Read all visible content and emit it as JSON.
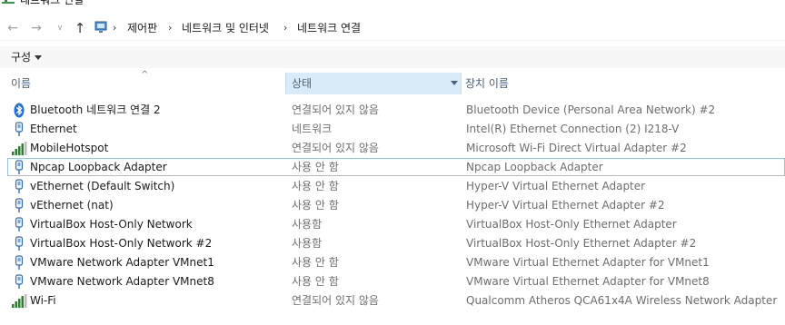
{
  "window": {
    "title": "네트워크 연결"
  },
  "address_bar": {
    "breadcrumbs": [
      "제어판",
      "네트워크 및 인터넷",
      "네트워크 연결"
    ],
    "separator": "›"
  },
  "toolbar": {
    "organize_label": "구성"
  },
  "columns": {
    "name": "이름",
    "status": "상태",
    "device": "장치 이름",
    "sort_indicator": "^"
  },
  "connections": [
    {
      "name": "Bluetooth 네트워크 연결 2",
      "status": "연결되어 있지 않음",
      "device": "Bluetooth Device (Personal Area Network) #2",
      "icon": "bluetooth-icon"
    },
    {
      "name": "Ethernet",
      "status": "네트워크",
      "device": "Intel(R) Ethernet Connection (2) I218-V",
      "icon": "ethernet-adapter-icon"
    },
    {
      "name": "MobileHotspot",
      "status": "연결되어 있지 않음",
      "device": "Microsoft Wi-Fi Direct Virtual Adapter #2",
      "icon": "wifi-signal-icon"
    },
    {
      "name": "Npcap Loopback Adapter",
      "status": "사용 안 함",
      "device": "Npcap Loopback Adapter",
      "icon": "ethernet-adapter-icon"
    },
    {
      "name": "vEthernet (Default Switch)",
      "status": "사용 안 함",
      "device": "Hyper-V Virtual Ethernet Adapter",
      "icon": "ethernet-adapter-icon"
    },
    {
      "name": "vEthernet (nat)",
      "status": "사용 안 함",
      "device": "Hyper-V Virtual Ethernet Adapter #2",
      "icon": "ethernet-adapter-icon"
    },
    {
      "name": "VirtualBox Host-Only Network",
      "status": "사용함",
      "device": "VirtualBox Host-Only Ethernet Adapter",
      "icon": "ethernet-adapter-icon"
    },
    {
      "name": "VirtualBox Host-Only Network #2",
      "status": "사용함",
      "device": "VirtualBox Host-Only Ethernet Adapter #2",
      "icon": "ethernet-adapter-icon"
    },
    {
      "name": "VMware Network Adapter VMnet1",
      "status": "사용 안 함",
      "device": "VMware Virtual Ethernet Adapter for VMnet1",
      "icon": "ethernet-adapter-icon"
    },
    {
      "name": "VMware Network Adapter VMnet8",
      "status": "사용 안 함",
      "device": "VMware Virtual Ethernet Adapter for VMnet8",
      "icon": "ethernet-adapter-icon"
    },
    {
      "name": "Wi-Fi",
      "status": "연결되어 있지 않음",
      "device": "Qualcomm Atheros QCA61x4A Wireless Network Adapter",
      "icon": "wifi-signal-icon"
    }
  ],
  "focused_row_index": 3,
  "colors": {
    "selected_header": "#d9ebf9",
    "focus_border": "#99c2e6",
    "header_text": "#4c607a",
    "secondary_text": "#6d6d6d"
  }
}
